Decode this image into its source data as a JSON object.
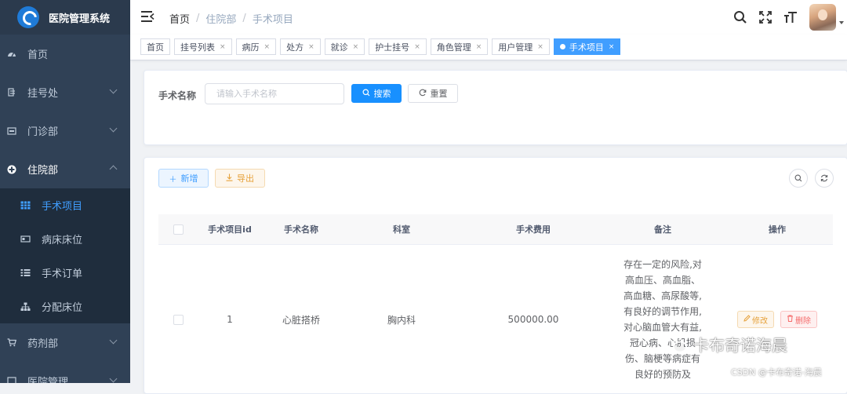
{
  "brand": {
    "title": "医院管理系统"
  },
  "sidebar": {
    "items": [
      {
        "label": "首页",
        "icon": "dashboard-icon"
      },
      {
        "label": "挂号处",
        "icon": "register-icon"
      },
      {
        "label": "门诊部",
        "icon": "clinic-icon"
      },
      {
        "label": "住院部",
        "icon": "inpatient-icon"
      },
      {
        "label": "药剂部",
        "icon": "cart-icon"
      },
      {
        "label": "医院管理",
        "icon": "manage-icon"
      }
    ],
    "submenu": [
      {
        "label": "手术项目",
        "icon": "table-icon",
        "active": true
      },
      {
        "label": "病床床位",
        "icon": "bed-icon"
      },
      {
        "label": "手术订单",
        "icon": "list-icon"
      },
      {
        "label": "分配床位",
        "icon": "tree-icon"
      }
    ]
  },
  "navbar": {
    "breadcrumb": [
      "首页",
      "住院部",
      "手术项目"
    ]
  },
  "tags": [
    {
      "label": "首页",
      "closable": false
    },
    {
      "label": "挂号列表",
      "closable": true
    },
    {
      "label": "病历",
      "closable": true
    },
    {
      "label": "处方",
      "closable": true
    },
    {
      "label": "就诊",
      "closable": true
    },
    {
      "label": "护士挂号",
      "closable": true
    },
    {
      "label": "角色管理",
      "closable": true
    },
    {
      "label": "用户管理",
      "closable": true
    },
    {
      "label": "手术项目",
      "closable": true,
      "active": true
    }
  ],
  "tag_close_symbol": "×",
  "search": {
    "label": "手术名称",
    "placeholder": "请输入手术名称",
    "search_btn": "搜索",
    "reset_btn": "重置"
  },
  "toolbar": {
    "add_btn": "新增",
    "export_btn": "导出"
  },
  "table": {
    "columns": [
      "手术项目id",
      "手术名称",
      "科室",
      "手术费用",
      "备注",
      "操作"
    ],
    "rows": [
      {
        "id": "1",
        "name": "心脏搭桥",
        "dept": "胸内科",
        "fee": "500000.00",
        "note": "存在一定的风险,对高血压、高血脂、高血糖、高尿酸等,有良好的调节作用,对心脑血管大有益,冠心病、心肌损伤、脑梗等病症有良好的预防及",
        "edit": "修改",
        "delete": "删除"
      }
    ]
  },
  "watermark": {
    "text": "卡布奇诺海晨",
    "csdn": "CSDN @卡布奇诺-海晨"
  },
  "colors": {
    "sidebar": "#304156",
    "primary": "#1890ff",
    "active_menu": "#409eff"
  }
}
